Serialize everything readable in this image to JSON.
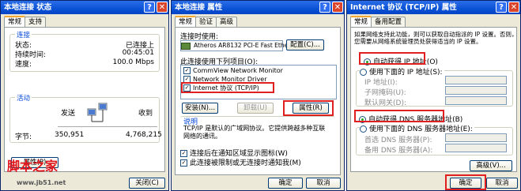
{
  "status_window": {
    "title": "本地连接 状态",
    "tabs": [
      "常规",
      "支持"
    ],
    "connection_group": "连接",
    "rows": [
      {
        "label": "状态:",
        "value": "已连接上"
      },
      {
        "label": "持续时间:",
        "value": "00:45:01"
      },
      {
        "label": "速度:",
        "value": "100.0 Mbps"
      }
    ],
    "activity_group": "活动",
    "sent_label": "发送",
    "received_label": "收到",
    "bytes_label": "字节:",
    "sent_bytes": "350,951",
    "received_bytes": "4,768,215",
    "properties_button": "属性(P)",
    "close_button": "关闭(C)"
  },
  "props_window": {
    "title": "本地连接 属性",
    "tabs": [
      "常规",
      "验证",
      "高级"
    ],
    "connect_using_label": "连接时使用:",
    "adapter_name": "Atheros AR8132 PCI-E Fast Ethe",
    "configure_button": "配置(C)...",
    "items_label": "此连接使用下列项目(O):",
    "items": [
      "CommView Network Monitor",
      "Network Monitor Driver",
      "Internet 协议 (TCP/IP)"
    ],
    "install_button": "安装(N)...",
    "uninstall_button": "卸载(U)",
    "properties_button": "属性(R)",
    "description_title": "说明",
    "description_text": "TCP/IP 是默认的广域网协议。它提供跨越多种互联网络的通讯。",
    "checkbox1": "连接后在通知区域显示图标(W)",
    "checkbox2": "此连接被限制或无连接时通知我(M)",
    "ok_button": "确定",
    "cancel_button": "取消"
  },
  "tcpip_window": {
    "title": "Internet 协议 (TCP/IP) 属性",
    "tabs": [
      "常规",
      "备用配置"
    ],
    "intro_text_1": "如果网络支持此功能，则可以获取自动指派的 IP 设置。否则，",
    "intro_text_2": "您需要从网络系统管理员处获得适当的 IP 设置。",
    "auto_ip": "自动获得 IP 地址(O)",
    "use_ip": "使用下面的 IP 地址(S):",
    "ip_label": "IP 地址(I):",
    "mask_label": "子网掩码(U):",
    "gateway_label": "默认网关(D):",
    "auto_dns": "自动获得 DNS 服务器地址(B)",
    "use_dns": "使用下面的 DNS 服务器地址(E):",
    "dns1_label": "首选 DNS 服务器(P):",
    "dns2_label": "备用 DNS 服务器(A):",
    "advanced_button": "高级(V)...",
    "ok_button": "确定",
    "cancel_button": "取消"
  },
  "watermark": {
    "line1": "脚本之家",
    "line2": "www.jb51.net"
  },
  "colors": {
    "title_bar": "#0a52d5",
    "highlight": "#e02020",
    "dialog_bg": "#ece9d8"
  }
}
